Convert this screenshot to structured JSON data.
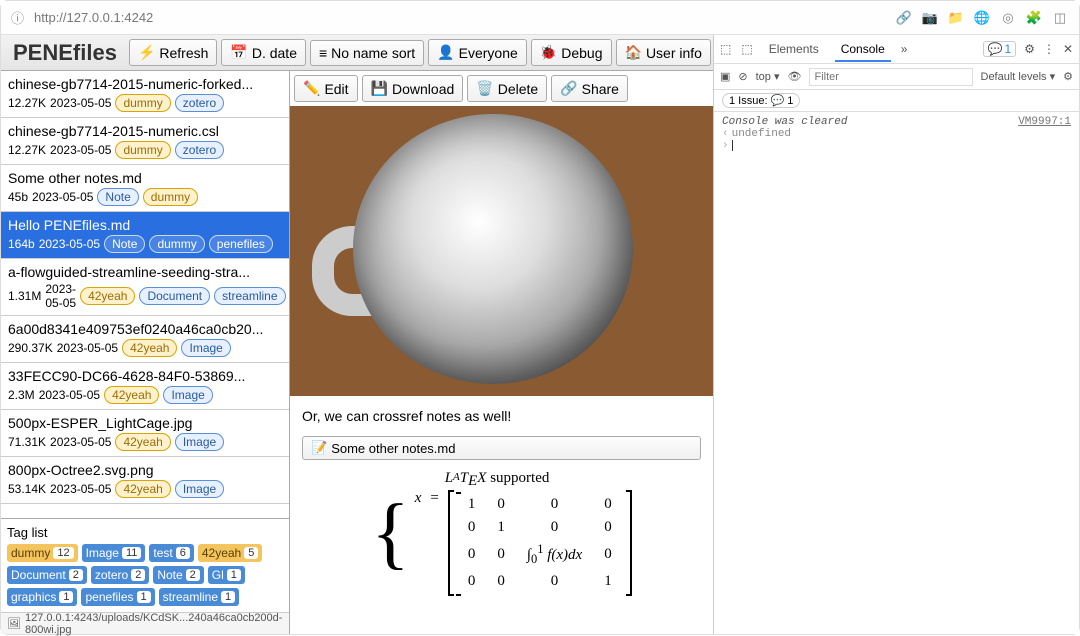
{
  "browser": {
    "url": "http://127.0.0.1:4242"
  },
  "header": {
    "title": "PENEfiles",
    "refresh": "Refresh",
    "ddate": "D. date",
    "namesort": "No name sort",
    "everyone": "Everyone",
    "debug": "Debug",
    "userinfo": "User info"
  },
  "files": [
    {
      "name": "chinese-gb7714-2015-numeric-forked...",
      "size": "12.27K",
      "date": "2023-05-05",
      "tags": [
        "dummy",
        "zotero"
      ]
    },
    {
      "name": "chinese-gb7714-2015-numeric.csl",
      "size": "12.27K",
      "date": "2023-05-05",
      "tags": [
        "dummy",
        "zotero"
      ]
    },
    {
      "name": "Some other notes.md",
      "size": "45b",
      "date": "2023-05-05",
      "tags": [
        "Note",
        "dummy"
      ]
    },
    {
      "name": "Hello PENEfiles.md",
      "size": "164b",
      "date": "2023-05-05",
      "tags": [
        "Note",
        "dummy",
        "penefiles"
      ],
      "selected": true
    },
    {
      "name": "a-flowguided-streamline-seeding-stra...",
      "size": "1.31M",
      "date": "2023-05-05",
      "tags": [
        "42yeah",
        "Document",
        "streamline"
      ]
    },
    {
      "name": "6a00d8341e409753ef0240a46ca0cb20...",
      "size": "290.37K",
      "date": "2023-05-05",
      "tags": [
        "42yeah",
        "Image"
      ]
    },
    {
      "name": "33FECC90-DC66-4628-84F0-53869...",
      "size": "2.3M",
      "date": "2023-05-05",
      "tags": [
        "42yeah",
        "Image"
      ]
    },
    {
      "name": "500px-ESPER_LightCage.jpg",
      "size": "71.31K",
      "date": "2023-05-05",
      "tags": [
        "42yeah",
        "Image"
      ]
    },
    {
      "name": "800px-Octree2.svg.png",
      "size": "53.14K",
      "date": "2023-05-05",
      "tags": [
        "42yeah",
        "Image"
      ]
    }
  ],
  "taglist": {
    "title": "Tag list",
    "tags": [
      {
        "name": "dummy",
        "count": "12",
        "c": "o"
      },
      {
        "name": "Image",
        "count": "11",
        "c": "b"
      },
      {
        "name": "test",
        "count": "6",
        "c": "b"
      },
      {
        "name": "42yeah",
        "count": "5",
        "c": "o"
      },
      {
        "name": "Document",
        "count": "2",
        "c": "b"
      },
      {
        "name": "zotero",
        "count": "2",
        "c": "b"
      },
      {
        "name": "Note",
        "count": "2",
        "c": "b"
      },
      {
        "name": "Gl",
        "count": "1",
        "c": "b"
      },
      {
        "name": "graphics",
        "count": "1",
        "c": "b"
      },
      {
        "name": "penefiles",
        "count": "1",
        "c": "b"
      },
      {
        "name": "streamline",
        "count": "1",
        "c": "b"
      }
    ]
  },
  "status": "127.0.0.1:4243/uploads/KCdSK...240a46ca0cb200d-800wi.jpg",
  "toolbar": {
    "edit": "Edit",
    "download": "Download",
    "delete": "Delete",
    "share": "Share"
  },
  "content": {
    "crossref": "Or, we can crossref notes as well!",
    "reflink": "Some other notes.md",
    "latex_caption": "supported"
  },
  "devtools": {
    "tabs": {
      "elements": "Elements",
      "console": "Console"
    },
    "top": "top",
    "filter_ph": "Filter",
    "levels": "Default levels",
    "issue": "1 Issue:",
    "issue_count": "1",
    "cleared": "Console was cleared",
    "src": "VM9997:1",
    "undef": "undefined",
    "errcount": "1"
  }
}
